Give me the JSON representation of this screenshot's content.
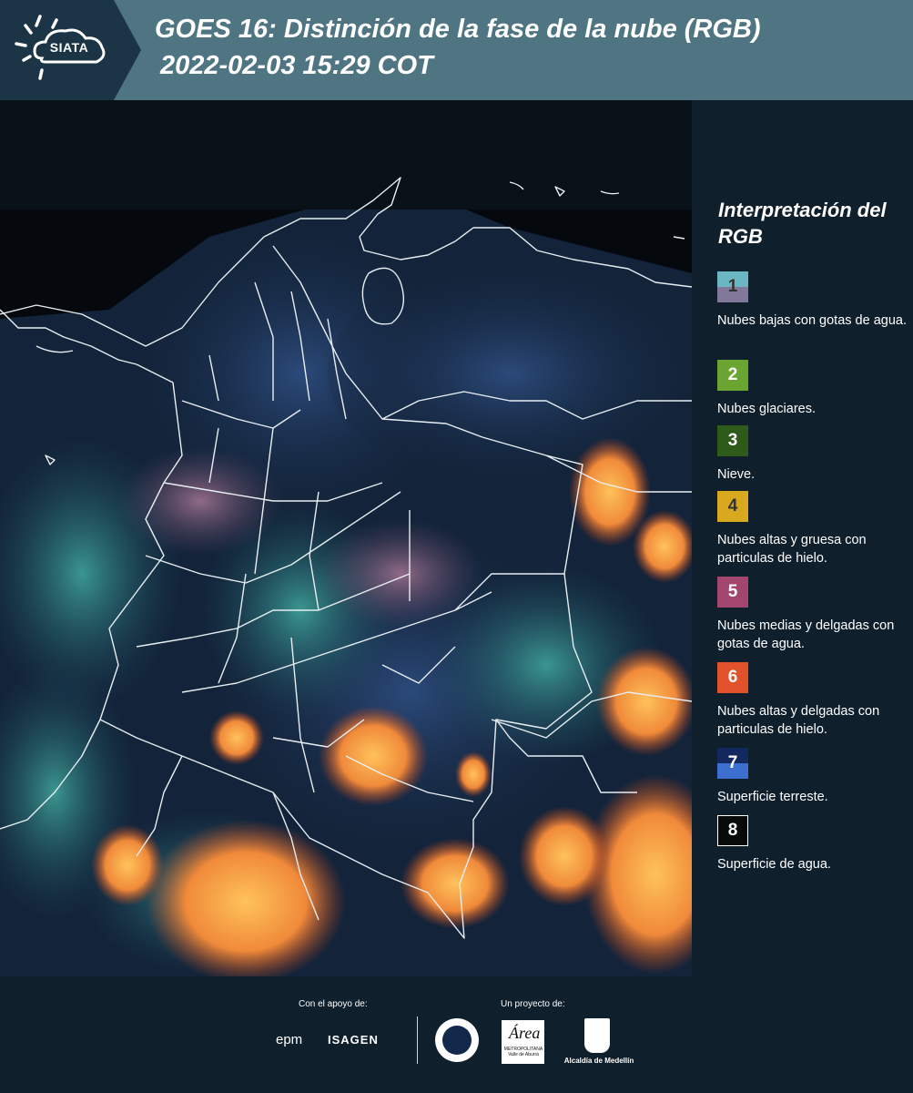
{
  "header": {
    "logo_text": "SIATA",
    "title_line1": "GOES 16: Distinción de la fase de la nube (RGB)",
    "title_line2": "2022-02-03 15:29 COT",
    "background_color": "#4f7482"
  },
  "legend": {
    "title": "Interpretación del RGB",
    "items": [
      {
        "number": "1",
        "label": "Nubes bajas con gotas de agua.",
        "color_top": "#6ab6c3",
        "color_bottom": "#81789a"
      },
      {
        "number": "2",
        "label": "Nubes glaciares.",
        "color": "#6aa431"
      },
      {
        "number": "3",
        "label": "Nieve.",
        "color": "#2e5a1a"
      },
      {
        "number": "4",
        "label": "Nubes altas y gruesa con particulas de hielo.",
        "color": "#d8a81e"
      },
      {
        "number": "5",
        "label": "Nubes medias y delgadas con gotas de agua.",
        "color": "#a2466e"
      },
      {
        "number": "6",
        "label": "Nubes altas y delgadas con particulas de hielo.",
        "color": "#e1512a"
      },
      {
        "number": "7",
        "label": "Superficie terreste.",
        "color_top": "#12285e",
        "color_bottom": "#3c6fd0"
      },
      {
        "number": "8",
        "label": "Superficie de agua.",
        "color": "#060a09"
      }
    ]
  },
  "footer": {
    "support_label": "Con el apoyo de:",
    "project_label": "Un proyecto de:",
    "sponsor_epm": "epm",
    "sponsor_isagen": "ISAGEN",
    "area_logo_letter": "Área",
    "area_logo_sub": "METROPOLITANA Valle de Aburrá",
    "alcaldia": "Alcaldía de Medellín"
  }
}
